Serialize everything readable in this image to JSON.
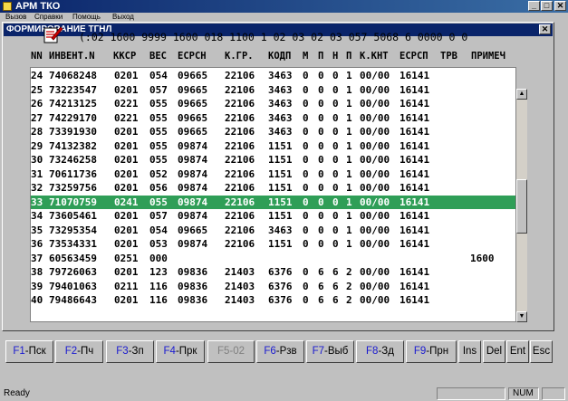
{
  "app": {
    "title": "АРМ ТКО",
    "menu": [
      "Вызов",
      "Справки",
      "Помощь",
      "Выход"
    ],
    "window_buttons": [
      "_",
      "□",
      "✕"
    ]
  },
  "dialog": {
    "title": "ФОРМИРОВАНИЕ ТГНЛ",
    "close": "✕",
    "info_line": "(:02 1600 9999 1600 018 1100 1 02 03 02 03 057 5068 6 0000 0 0"
  },
  "table": {
    "headers": [
      "NN",
      "ИНВЕНТ.N",
      "ККСР",
      "ВЕС",
      "ЕСРСН",
      "К.ГР.",
      "КОДП",
      "М",
      "П",
      "Н",
      "П",
      "К.КНТ",
      "ЕСРСП",
      "ТРВ",
      "ПРИМЕЧ"
    ],
    "selected_index": 9,
    "rows": [
      [
        "24",
        "74068248",
        "0201",
        "054",
        "09665",
        "22106",
        "3463",
        "0",
        "0",
        "0",
        "1",
        "00/00",
        "16141",
        ""
      ],
      [
        "25",
        "73223547",
        "0201",
        "057",
        "09665",
        "22106",
        "3463",
        "0",
        "0",
        "0",
        "1",
        "00/00",
        "16141",
        ""
      ],
      [
        "26",
        "74213125",
        "0221",
        "055",
        "09665",
        "22106",
        "3463",
        "0",
        "0",
        "0",
        "1",
        "00/00",
        "16141",
        ""
      ],
      [
        "27",
        "74229170",
        "0221",
        "055",
        "09665",
        "22106",
        "3463",
        "0",
        "0",
        "0",
        "1",
        "00/00",
        "16141",
        ""
      ],
      [
        "28",
        "73391930",
        "0201",
        "055",
        "09665",
        "22106",
        "3463",
        "0",
        "0",
        "0",
        "1",
        "00/00",
        "16141",
        ""
      ],
      [
        "29",
        "74132382",
        "0201",
        "055",
        "09874",
        "22106",
        "1151",
        "0",
        "0",
        "0",
        "1",
        "00/00",
        "16141",
        ""
      ],
      [
        "30",
        "73246258",
        "0201",
        "055",
        "09874",
        "22106",
        "1151",
        "0",
        "0",
        "0",
        "1",
        "00/00",
        "16141",
        ""
      ],
      [
        "31",
        "70611736",
        "0201",
        "052",
        "09874",
        "22106",
        "1151",
        "0",
        "0",
        "0",
        "1",
        "00/00",
        "16141",
        ""
      ],
      [
        "32",
        "73259756",
        "0201",
        "056",
        "09874",
        "22106",
        "1151",
        "0",
        "0",
        "0",
        "1",
        "00/00",
        "16141",
        ""
      ],
      [
        "33",
        "71070759",
        "0241",
        "055",
        "09874",
        "22106",
        "1151",
        "0",
        "0",
        "0",
        "1",
        "00/00",
        "16141",
        ""
      ],
      [
        "34",
        "73605461",
        "0201",
        "057",
        "09874",
        "22106",
        "1151",
        "0",
        "0",
        "0",
        "1",
        "00/00",
        "16141",
        ""
      ],
      [
        "35",
        "73295354",
        "0201",
        "054",
        "09665",
        "22106",
        "3463",
        "0",
        "0",
        "0",
        "1",
        "00/00",
        "16141",
        ""
      ],
      [
        "36",
        "73534331",
        "0201",
        "053",
        "09874",
        "22106",
        "1151",
        "0",
        "0",
        "0",
        "1",
        "00/00",
        "16141",
        ""
      ],
      [
        "37",
        "60563459",
        "0251",
        "000",
        "",
        "",
        "",
        "",
        "",
        "",
        "",
        "",
        "",
        "1600"
      ],
      [
        "38",
        "79726063",
        "0201",
        "123",
        "09836",
        "21403",
        "6376",
        "0",
        "6",
        "6",
        "2",
        "00/00",
        "16141",
        ""
      ],
      [
        "39",
        "79401063",
        "0211",
        "116",
        "09836",
        "21403",
        "6376",
        "0",
        "6",
        "6",
        "2",
        "00/00",
        "16141",
        ""
      ],
      [
        "40",
        "79486643",
        "0201",
        "116",
        "09836",
        "21403",
        "6376",
        "0",
        "6",
        "6",
        "2",
        "00/00",
        "16141",
        ""
      ]
    ]
  },
  "scrollbar": {
    "up": "▲",
    "down": "▼"
  },
  "function_keys": [
    {
      "fn": "F1",
      "label": "-Пск"
    },
    {
      "fn": "F2",
      "label": "-Пч"
    },
    {
      "fn": "F3",
      "label": "-Зп"
    },
    {
      "fn": "F4",
      "label": "-Прк"
    },
    {
      "fn": "F5",
      "label": "-02"
    },
    {
      "fn": "F6",
      "label": "-Рзв"
    },
    {
      "fn": "F7",
      "label": "-Выб"
    },
    {
      "fn": "F8",
      "label": "-Зд"
    },
    {
      "fn": "F9",
      "label": "-Прн"
    }
  ],
  "edit_keys": [
    "Ins",
    "Del",
    "Ent",
    "Esc"
  ],
  "status": {
    "ready": "Ready",
    "num": "NUM"
  }
}
